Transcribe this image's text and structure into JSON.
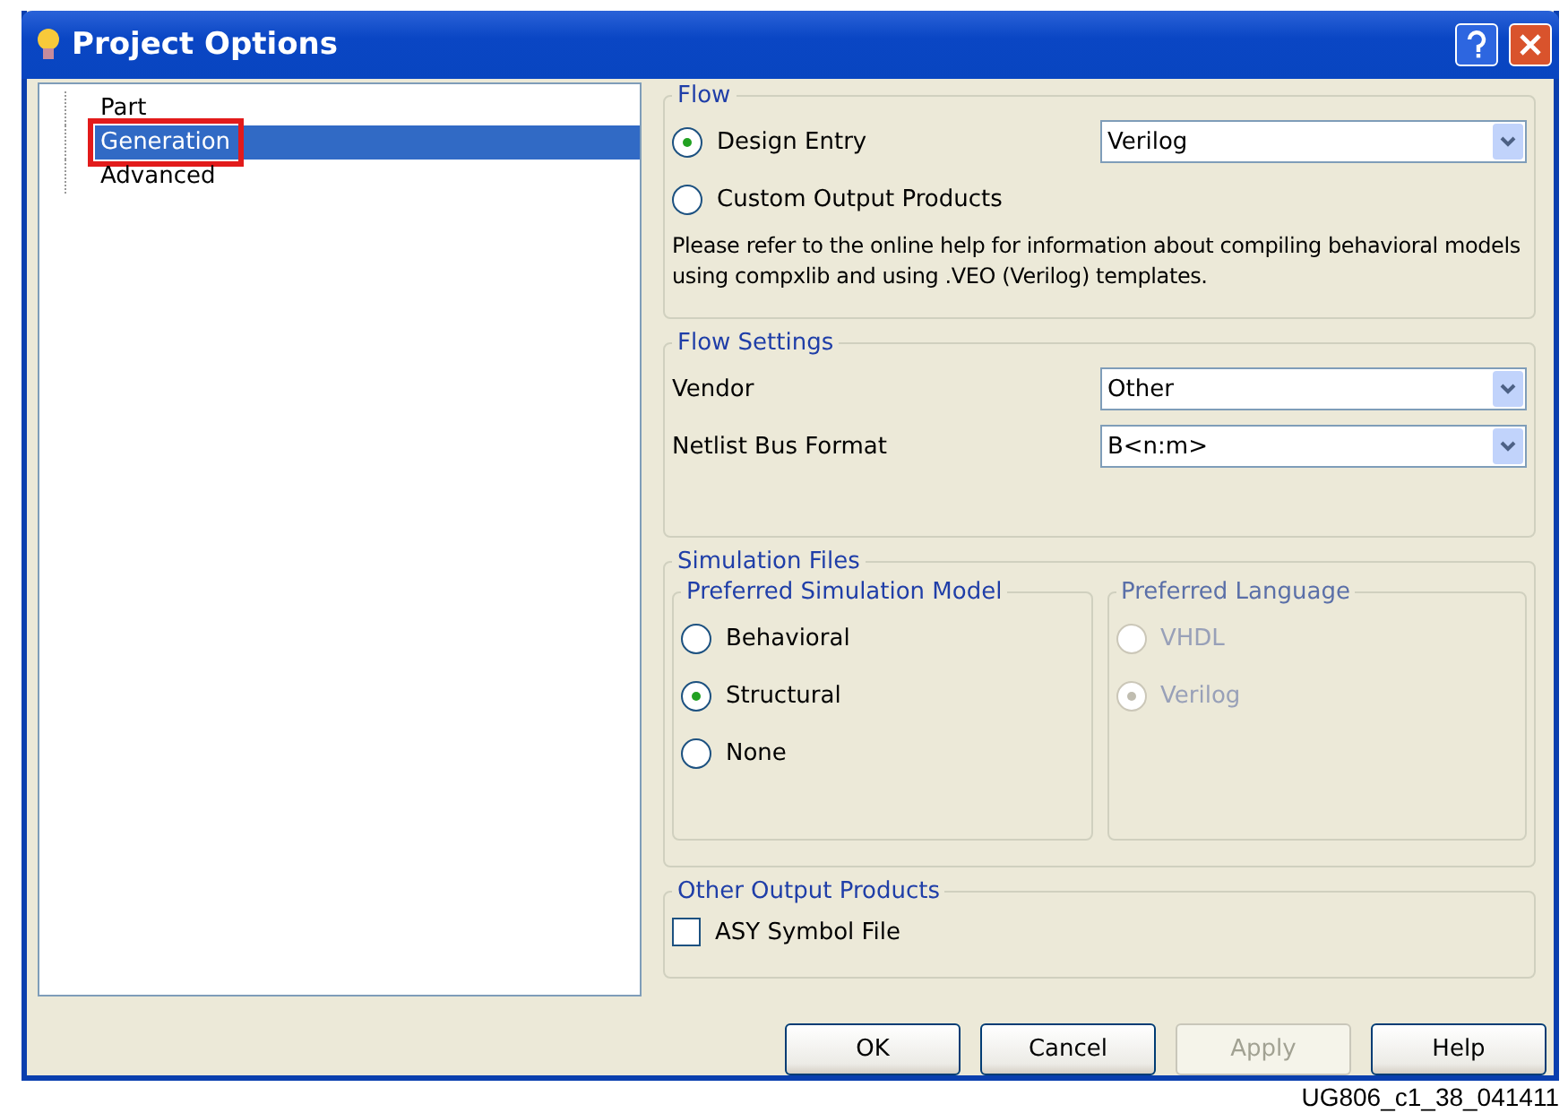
{
  "window": {
    "title": "Project Options"
  },
  "tree": {
    "items": [
      {
        "label": "Part",
        "selected": false
      },
      {
        "label": "Generation",
        "selected": true
      },
      {
        "label": "Advanced",
        "selected": false
      }
    ]
  },
  "flow": {
    "title": "Flow",
    "options": [
      {
        "label": "Design Entry",
        "selected": true
      },
      {
        "label": "Custom Output Products",
        "selected": false
      }
    ],
    "design_entry_value": "Verilog",
    "note": "Please refer to the online help for information about compiling behavioral models using compxlib and using .VEO (Verilog) templates."
  },
  "flow_settings": {
    "title": "Flow Settings",
    "fields": [
      {
        "label": "Vendor",
        "value": "Other"
      },
      {
        "label": "Netlist Bus Format",
        "value": "B<n:m>"
      }
    ]
  },
  "simulation_files": {
    "title": "Simulation Files",
    "groups": [
      {
        "title": "Preferred Simulation Model",
        "disabled": false,
        "options": [
          {
            "label": "Behavioral",
            "selected": false
          },
          {
            "label": "Structural",
            "selected": true
          },
          {
            "label": "None",
            "selected": false
          }
        ]
      },
      {
        "title": "Preferred Language",
        "disabled": true,
        "options": [
          {
            "label": "VHDL",
            "selected": false
          },
          {
            "label": "Verilog",
            "selected": true
          }
        ]
      }
    ]
  },
  "other_output_products": {
    "title": "Other Output Products",
    "checkboxes": [
      {
        "label": "ASY Symbol File",
        "checked": false
      }
    ]
  },
  "buttons": [
    {
      "label": "OK",
      "disabled": false
    },
    {
      "label": "Cancel",
      "disabled": false
    },
    {
      "label": "Apply",
      "disabled": true
    },
    {
      "label": "Help",
      "disabled": false
    }
  ],
  "caption": "UG806_c1_38_041411"
}
